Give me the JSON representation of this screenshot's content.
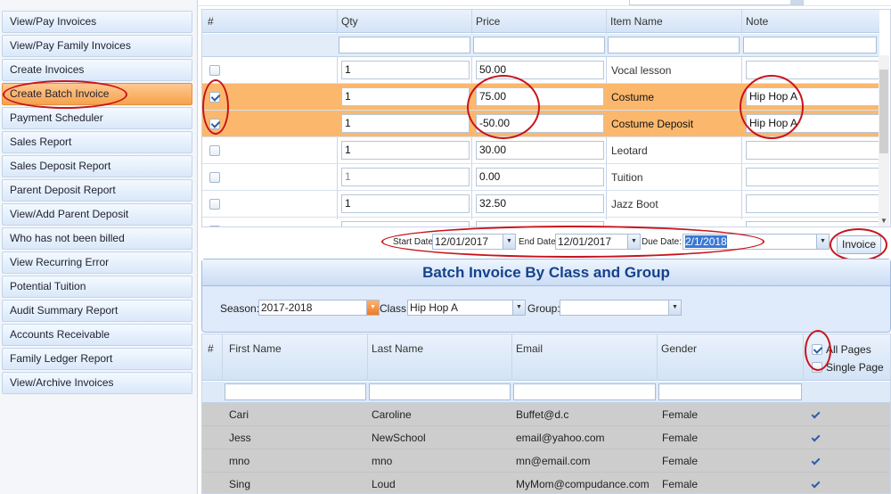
{
  "sidebar": {
    "items": [
      {
        "label": "View/Pay Invoices"
      },
      {
        "label": "View/Pay Family Invoices"
      },
      {
        "label": "Create Invoices"
      },
      {
        "label": "Create Batch Invoice",
        "active": true
      },
      {
        "label": "Payment Scheduler"
      },
      {
        "label": "Sales Report"
      },
      {
        "label": "Sales Deposit Report"
      },
      {
        "label": "Parent Deposit Report"
      },
      {
        "label": "View/Add Parent Deposit"
      },
      {
        "label": "Who has not been billed"
      },
      {
        "label": "View Recurring Error"
      },
      {
        "label": "Potential Tuition"
      },
      {
        "label": "Audit Summary Report"
      },
      {
        "label": "Accounts Receivable"
      },
      {
        "label": "Family Ledger Report"
      },
      {
        "label": "View/Archive Invoices"
      }
    ]
  },
  "items_grid": {
    "columns": [
      "#",
      "Qty",
      "Price",
      "Item Name",
      "Note"
    ],
    "rows": [
      {
        "checked": false,
        "qty": "1",
        "price": "50.00",
        "item": "Vocal lesson",
        "note": ""
      },
      {
        "checked": true,
        "qty": "1",
        "price": "75.00",
        "item": "Costume",
        "note": "Hip Hop A"
      },
      {
        "checked": true,
        "qty": "1",
        "price": "-50.00",
        "item": "Costume Deposit",
        "note": "Hip Hop A"
      },
      {
        "checked": false,
        "qty": "1",
        "price": "30.00",
        "item": "Leotard",
        "note": ""
      },
      {
        "checked": false,
        "qty": "1",
        "price": "0.00",
        "item": "Tuition",
        "note": ""
      },
      {
        "checked": false,
        "qty": "1",
        "price": "32.50",
        "item": "Jazz Boot",
        "note": ""
      }
    ]
  },
  "dates": {
    "start_label": "Start Date",
    "start_value": "12/01/2017",
    "end_label": "End Date",
    "end_value": "12/01/2017",
    "due_label": "Due Date:",
    "due_value": "2/1/2018"
  },
  "invoice_button": "Invoice",
  "batch_panel": {
    "title": "Batch Invoice By Class and Group",
    "season_label": "Season:",
    "season_value": "2017-2018",
    "class_label": "Class:",
    "class_value": "Hip Hop A",
    "group_label": "Group:",
    "group_value": ""
  },
  "students_grid": {
    "columns": [
      "#",
      "First Name",
      "Last Name",
      "Email",
      "Gender"
    ],
    "all_pages_label": "All Pages",
    "single_page_label": "Single Page",
    "rows": [
      {
        "first": "Cari",
        "last": "Caroline",
        "email": "Buffet@d.c",
        "gender": "Female"
      },
      {
        "first": "Jess",
        "last": "NewSchool",
        "email": "email@yahoo.com",
        "gender": "Female"
      },
      {
        "first": "mno",
        "last": "mno",
        "email": "mn@email.com",
        "gender": "Female"
      },
      {
        "first": "Sing",
        "last": "Loud",
        "email": "MyMom@compudance.com",
        "gender": "Female"
      }
    ]
  },
  "colors": {
    "selected_row": "#fbb86d",
    "annotation": "#c8141c",
    "title_text": "#15428b"
  }
}
